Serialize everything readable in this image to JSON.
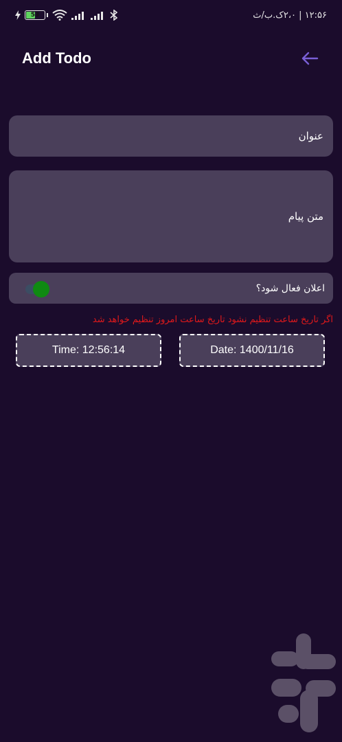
{
  "status_bar": {
    "time": "۱۲:۵۶ | ۲،۰ک.ب/ث",
    "battery_level": "53",
    "battery_percent": 53,
    "icons": [
      "charging-bolt-icon",
      "battery-icon",
      "wifi-icon",
      "signal-icon",
      "signal-icon",
      "bluetooth-icon"
    ]
  },
  "app_bar": {
    "title": "Add Todo",
    "back_icon": "arrow-left-icon"
  },
  "form": {
    "title_placeholder": "عنوان",
    "message_placeholder": "متن پیام",
    "notify_label": "اعلان فعال شود؟",
    "notify_enabled": true,
    "warning": "اگر تاریخ ساعت تنظیم نشود تاریخ ساعت امروز تنظیم خواهد شد",
    "time_label": "Time: 12:56:14",
    "date_label": "Date: 1400/11/16"
  },
  "colors": {
    "background": "#1b0c2c",
    "field": "#4a3f5a",
    "accent": "#7a5fd6",
    "switch_on": "#0f8a12",
    "warning": "#e0191b"
  },
  "watermark_icon": "store-logo-icon"
}
